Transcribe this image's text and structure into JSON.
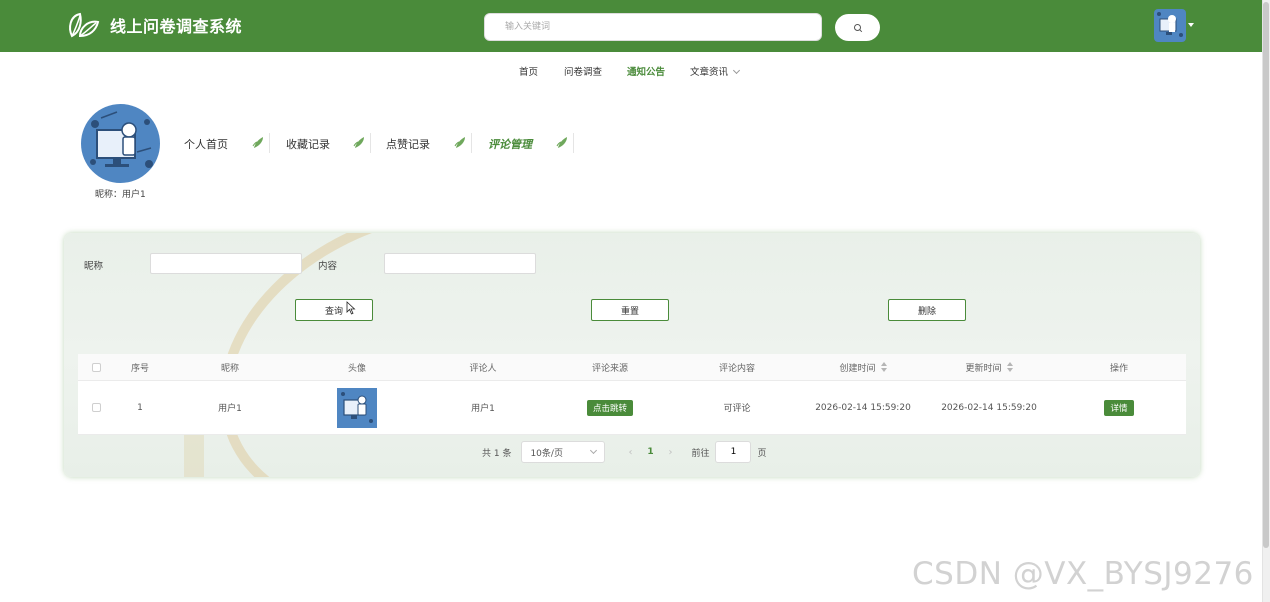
{
  "header": {
    "title": "线上问卷调查系统",
    "search_placeholder": "输入关键词"
  },
  "nav": {
    "items": [
      {
        "label": "首页",
        "active": false
      },
      {
        "label": "问卷调查",
        "active": false
      },
      {
        "label": "通知公告",
        "active": true
      },
      {
        "label": "文章资讯",
        "active": false,
        "dropdown": true
      }
    ]
  },
  "profile": {
    "nickname_label": "昵称：",
    "nickname": "用户1"
  },
  "user_tabs": [
    {
      "label": "个人首页",
      "active": false
    },
    {
      "label": "收藏记录",
      "active": false
    },
    {
      "label": "点赞记录",
      "active": false
    },
    {
      "label": "评论管理",
      "active": true
    }
  ],
  "filter": {
    "nickname_label": "昵称",
    "content_label": "内容",
    "search_button": "查询",
    "reset_button": "重置",
    "delete_button": "删除"
  },
  "table": {
    "columns": [
      "序号",
      "昵称",
      "头像",
      "评论人",
      "评论来源",
      "评论内容",
      "创建时间",
      "更新时间",
      "操作"
    ],
    "rows": [
      {
        "index": "1",
        "nickname": "用户1",
        "commenter": "用户1",
        "source": "点击跳转",
        "content": "可评论",
        "created": "2026-02-14 15:59:20",
        "updated": "2026-02-14 15:59:20",
        "action": "详情"
      }
    ]
  },
  "pagination": {
    "total": "共 1 条",
    "page_size": "10条/页",
    "prev": "‹",
    "current": "1",
    "next": "›",
    "goto_label": "前往",
    "goto_value": "1",
    "page_unit": "页"
  },
  "watermark": "CSDN @VX_BYSJ9276",
  "colors": {
    "primary": "#4a8b3a",
    "header_bg": "#4a8b3a"
  },
  "icons": {
    "logo": "leaf-logo-icon",
    "search": "search-icon",
    "tab_decoration": "leaf-icon"
  }
}
